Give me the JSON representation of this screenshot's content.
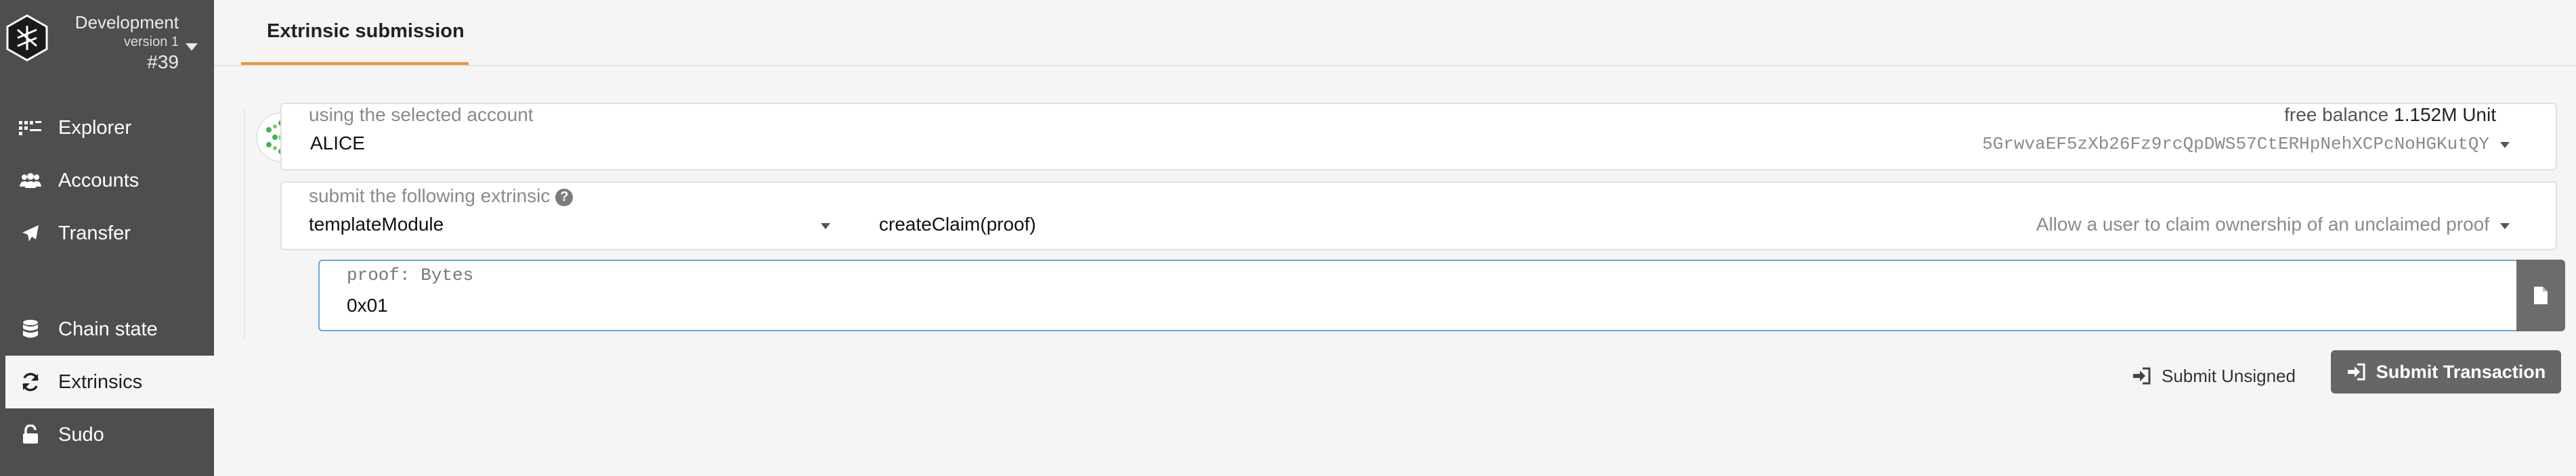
{
  "sidebar": {
    "chain": {
      "name": "Development",
      "version": "version 1",
      "block": "#39"
    },
    "items": [
      {
        "label": "Explorer",
        "icon": "grid-dots-icon"
      },
      {
        "label": "Accounts",
        "icon": "users-icon"
      },
      {
        "label": "Transfer",
        "icon": "paper-plane-icon"
      },
      {
        "label": "Chain state",
        "icon": "database-icon"
      },
      {
        "label": "Extrinsics",
        "icon": "sync-icon"
      },
      {
        "label": "Sudo",
        "icon": "unlock-icon"
      }
    ],
    "active_item": "Extrinsics"
  },
  "tabs": [
    {
      "label": "Extrinsic submission",
      "active": true
    }
  ],
  "account": {
    "label": "using the selected account",
    "name": "ALICE",
    "balance_label": "free balance",
    "balance_value": "1.152M Unit",
    "address": "5GrwvaEF5zXb26Fz9rcQpDWS57CtERHpNehXCPcNoHGKutQY"
  },
  "extrinsic": {
    "label": "submit the following extrinsic",
    "module": "templateModule",
    "method": "createClaim(proof)",
    "description": "Allow a user to claim ownership of an unclaimed proof"
  },
  "param": {
    "label": "proof: Bytes",
    "value": "0x01"
  },
  "actions": {
    "unsigned_label": "Submit Unsigned",
    "submit_label": "Submit Transaction"
  },
  "colors": {
    "sidebar": "#4e4e4e",
    "tab_accent": "#f19135",
    "focus_border": "#6aa6d6",
    "button": "#666666"
  }
}
